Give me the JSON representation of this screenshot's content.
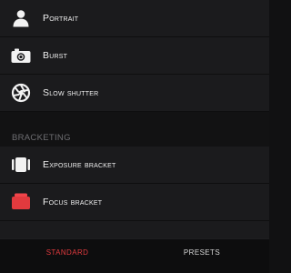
{
  "list": {
    "items": [
      {
        "label": "Portrait",
        "icon": "portrait-icon"
      },
      {
        "label": "Burst",
        "icon": "burst-camera-icon"
      },
      {
        "label": "Slow shutter",
        "icon": "aperture-icon"
      }
    ],
    "bracketing": {
      "header": "BRACKETING",
      "items": [
        {
          "label": "Exposure bracket",
          "icon": "exposure-bracket-icon"
        },
        {
          "label": "Focus bracket",
          "icon": "focus-bracket-icon"
        }
      ]
    }
  },
  "tabs": [
    {
      "label": "STANDARD",
      "active": true
    },
    {
      "label": "PRESETS",
      "active": false
    }
  ],
  "colors": {
    "accent": "#e23a3e",
    "background": "#1b1b1d",
    "section_text": "#6e6e72"
  }
}
